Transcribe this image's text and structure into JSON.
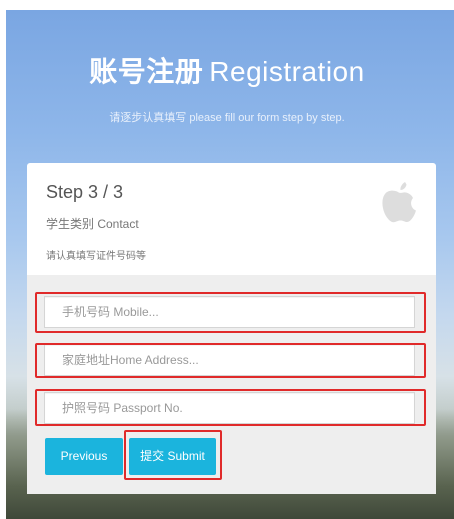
{
  "header": {
    "title_cn": "账号注册",
    "title_en": "Registration",
    "subtitle": "请逐步认真填写 please fill our form step by step."
  },
  "form": {
    "step": "Step 3 / 3",
    "section": "学生类别 Contact",
    "hint": "请认真填写证件号码等",
    "logo_icon": "apple-icon",
    "fields": [
      {
        "placeholder": "手机号码 Mobile..."
      },
      {
        "placeholder": "家庭地址Home Address..."
      },
      {
        "placeholder": "护照号码 Passport No."
      }
    ],
    "buttons": {
      "previous": "Previous",
      "submit": "提交 Submit"
    }
  },
  "colors": {
    "accent": "#1bb4dd",
    "highlight": "#e02a2a"
  }
}
